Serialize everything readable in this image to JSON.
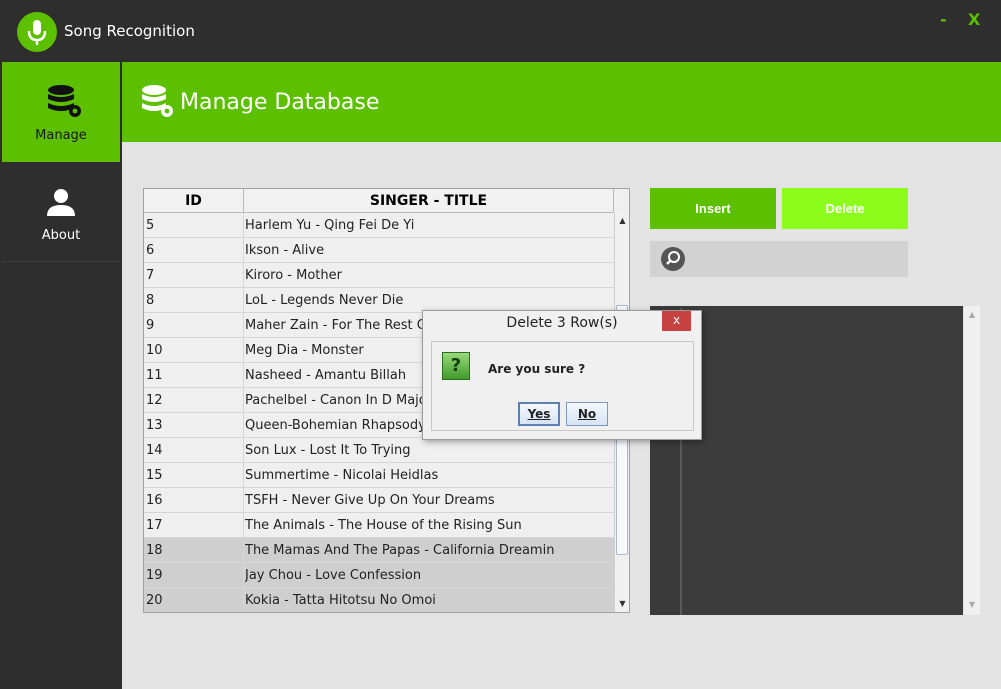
{
  "window": {
    "title": "Song Recognition",
    "minimize_label": "-",
    "close_label": "X",
    "accent_color": "#5cbf00"
  },
  "sidebar": {
    "items": [
      {
        "label": "Manage",
        "icon": "database-gear-icon",
        "active": true
      },
      {
        "label": "About",
        "icon": "user-icon",
        "active": false
      }
    ]
  },
  "header": {
    "title": "Manage Database",
    "icon": "database-gear-icon"
  },
  "table": {
    "columns": [
      "ID",
      "SINGER - TITLE"
    ],
    "rows": [
      {
        "id": "5",
        "song": "Harlem Yu - Qing Fei De Yi",
        "selected": false
      },
      {
        "id": "6",
        "song": "Ikson - Alive",
        "selected": false
      },
      {
        "id": "7",
        "song": "Kiroro - Mother",
        "selected": false
      },
      {
        "id": "8",
        "song": "LoL - Legends Never Die",
        "selected": false
      },
      {
        "id": "9",
        "song": "Maher Zain - For The Rest Of My Life",
        "selected": false
      },
      {
        "id": "10",
        "song": "Meg Dia - Monster",
        "selected": false
      },
      {
        "id": "11",
        "song": "Nasheed - Amantu Billah",
        "selected": false
      },
      {
        "id": "12",
        "song": "Pachelbel - Canon In D Major",
        "selected": false
      },
      {
        "id": "13",
        "song": "Queen-Bohemian Rhapsody",
        "selected": false
      },
      {
        "id": "14",
        "song": "Son Lux - Lost It To Trying",
        "selected": false
      },
      {
        "id": "15",
        "song": "Summertime - Nicolai Heidlas",
        "selected": false
      },
      {
        "id": "16",
        "song": "TSFH - Never Give Up On Your Dreams",
        "selected": false
      },
      {
        "id": "17",
        "song": "The Animals  - The House of the Rising Sun",
        "selected": false
      },
      {
        "id": "18",
        "song": "The Mamas And The Papas - California Dreamin",
        "selected": true
      },
      {
        "id": "19",
        "song": "Jay Chou - Love Confession",
        "selected": true
      },
      {
        "id": "20",
        "song": "Kokia - Tatta Hitotsu No Omoi",
        "selected": true
      }
    ]
  },
  "actions": {
    "insert_label": "Insert",
    "delete_label": "Delete"
  },
  "search": {
    "placeholder": "",
    "value": ""
  },
  "dialog": {
    "title": "Delete 3 Row(s)",
    "message": "Are you sure ?",
    "yes_label": "Yes",
    "no_label": "No",
    "close_label": "x"
  }
}
